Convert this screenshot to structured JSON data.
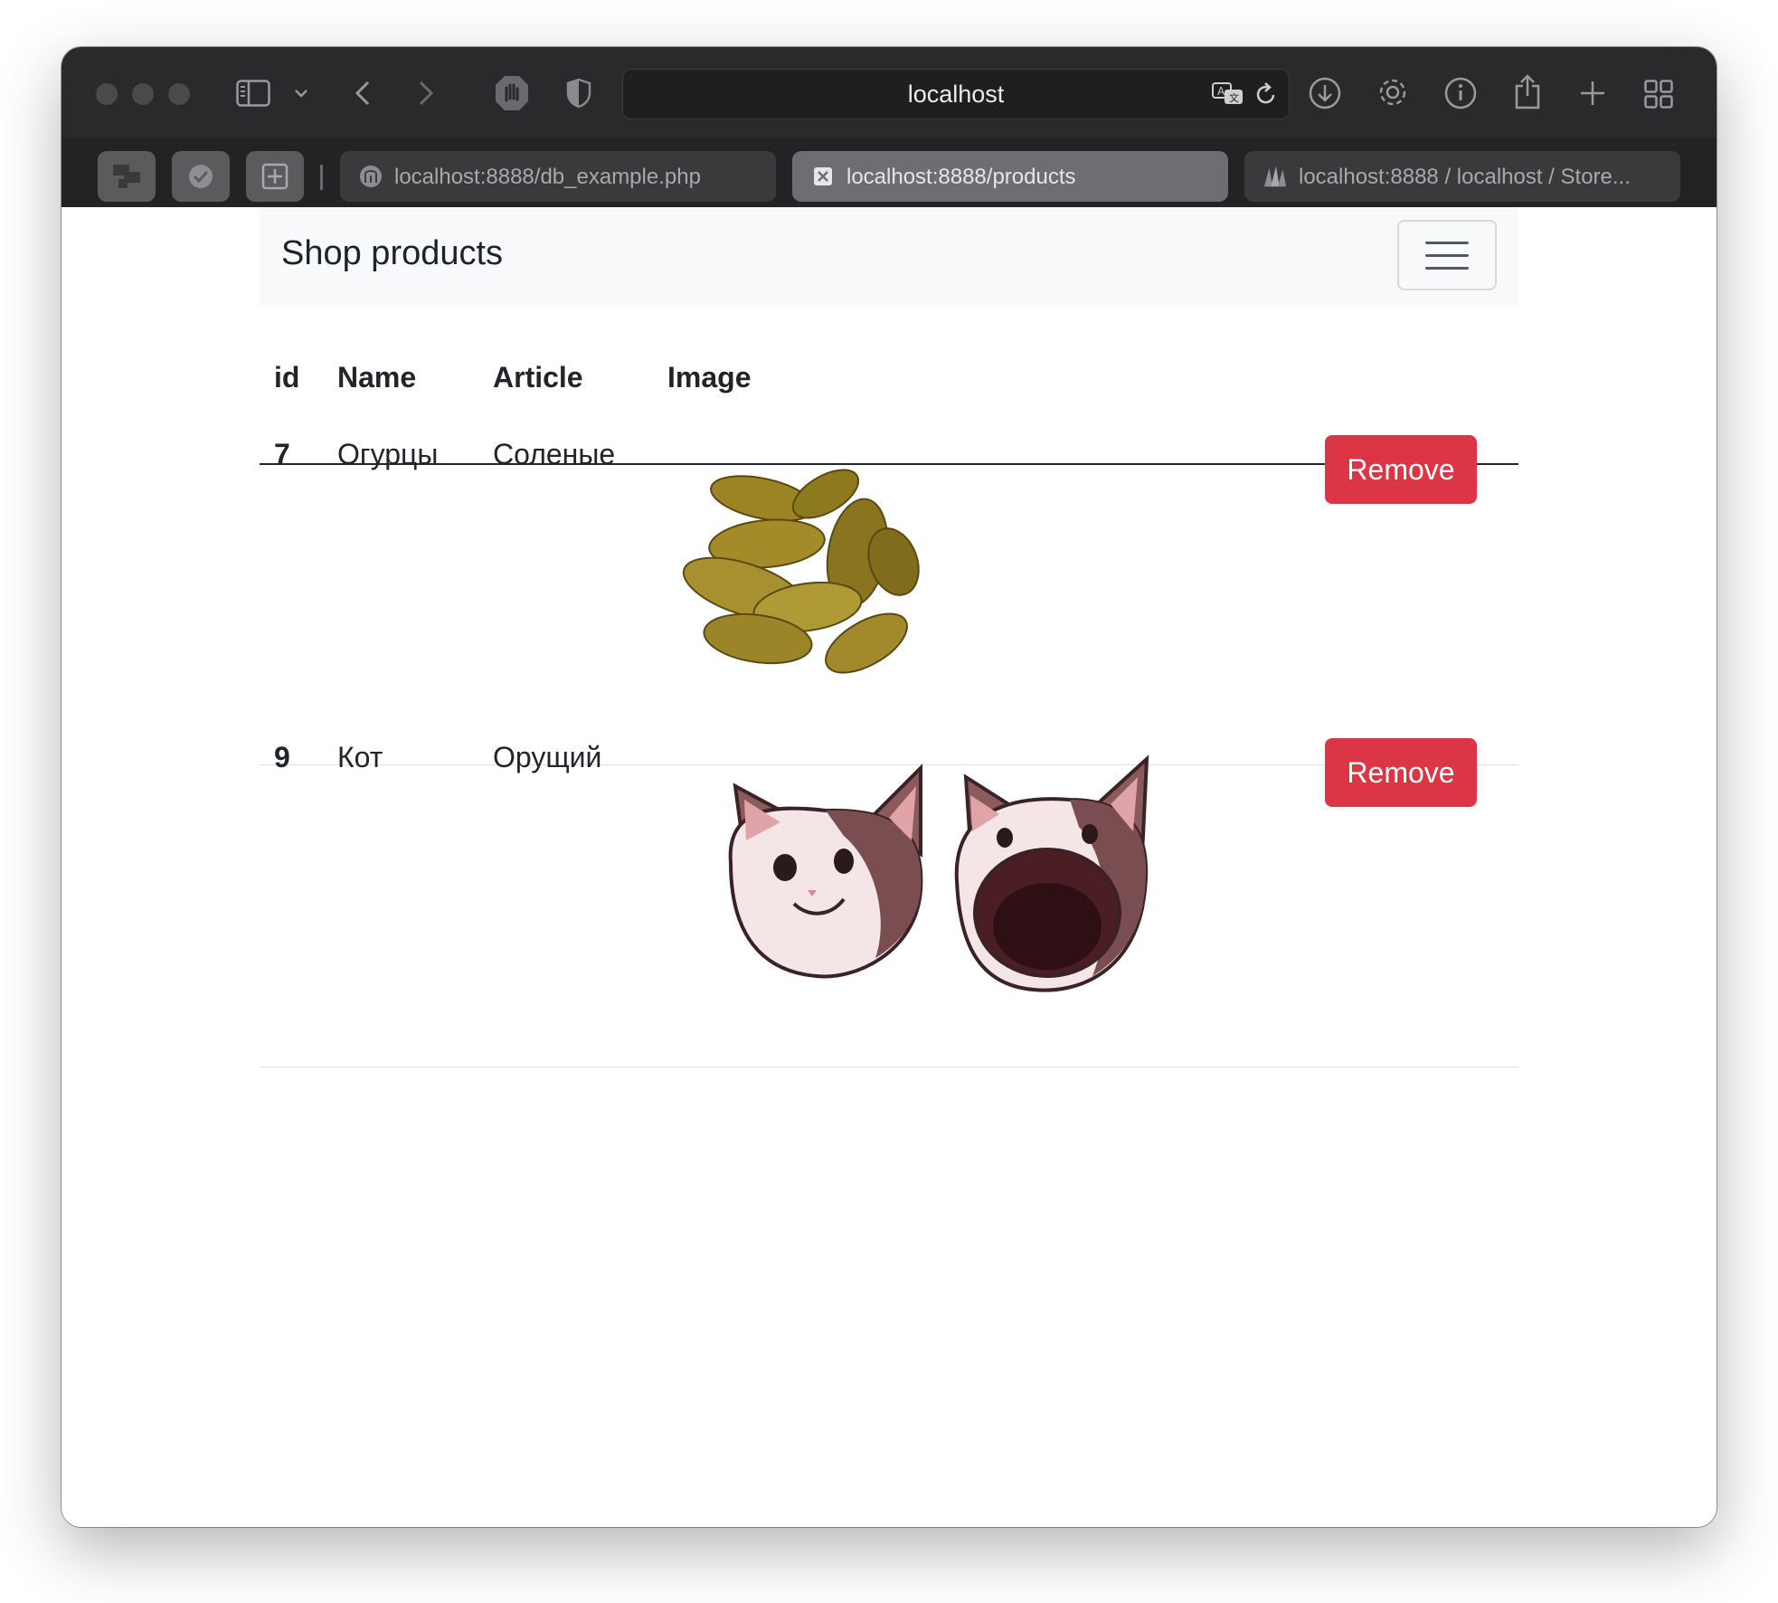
{
  "browser": {
    "address_host": "localhost",
    "tabs": [
      {
        "label": "localhost:8888/db_example.php",
        "favicon": "elephant-icon"
      },
      {
        "label": "localhost:8888/products",
        "favicon": "close-tab-icon"
      },
      {
        "label": "localhost:8888 / localhost / Store...",
        "favicon": "phpmyadmin-icon"
      }
    ]
  },
  "navbar": {
    "brand": "Shop products"
  },
  "table": {
    "headers": [
      "id",
      "Name",
      "Article",
      "Image"
    ],
    "rows": [
      {
        "id": "7",
        "name": "Огурцы",
        "article": "Соленые",
        "image": "pickles-image",
        "action": "Remove"
      },
      {
        "id": "9",
        "name": "Кот",
        "article": "Орущий",
        "image": "pop-cat-image",
        "action": "Remove"
      }
    ]
  },
  "colors": {
    "danger": "#dc3545",
    "navbar_bg": "#f8f9fa",
    "chrome_bg": "#2a2a2c"
  }
}
